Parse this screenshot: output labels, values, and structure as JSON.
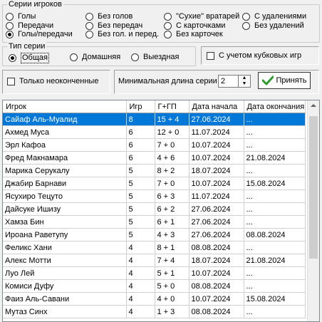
{
  "player_series": {
    "legend": "Серии игроков",
    "options": [
      {
        "label": "Голы",
        "selected": false
      },
      {
        "label": "Передачи",
        "selected": false
      },
      {
        "label": "Голы/передачи",
        "selected": true
      },
      {
        "label": "Без голов",
        "selected": false
      },
      {
        "label": "Без передач",
        "selected": false
      },
      {
        "label": "Без гол. и перед.",
        "selected": false
      },
      {
        "label": "\"Сухие\" вратарей",
        "selected": false
      },
      {
        "label": "С карточками",
        "selected": false
      },
      {
        "label": "Без карточек",
        "selected": false
      },
      {
        "label": "С удалениями",
        "selected": false
      },
      {
        "label": "Без удалений",
        "selected": false
      }
    ]
  },
  "series_type": {
    "legend": "Тип серии",
    "options": [
      {
        "label": "Общая",
        "selected": true
      },
      {
        "label": "Домашняя",
        "selected": false
      },
      {
        "label": "Выездная",
        "selected": false
      }
    ]
  },
  "cup_games_label": "С учетом кубковых игр",
  "unfinished_label": "Только неоконченные",
  "min_length_label": "Минимальная длина серии",
  "min_length_value": "2",
  "accept_label": "Принять",
  "table": {
    "columns": [
      "Игрок",
      "Игр",
      "Г+ГП",
      "Дата начала",
      "Дата окончания"
    ],
    "selected_row": 0,
    "rows": [
      [
        "Сайаф Аль-Муалид",
        "8",
        "15 + 4",
        "27.06.2024",
        "..."
      ],
      [
        "Ахмед Муса",
        "6",
        "12 + 0",
        "11.07.2024",
        "..."
      ],
      [
        "Эрл Кафоа",
        "6",
        "7 + 0",
        "10.07.2024",
        "..."
      ],
      [
        "Фред Макнамара",
        "6",
        "4 + 6",
        "10.07.2024",
        "21.08.2024"
      ],
      [
        "Марика Серукалу",
        "5",
        "8 + 2",
        "18.07.2024",
        "..."
      ],
      [
        "Джабир Барнави",
        "5",
        "7 + 0",
        "10.07.2024",
        "15.08.2024"
      ],
      [
        "Ясухиро Тецуто",
        "5",
        "6 + 3",
        "11.07.2024",
        "..."
      ],
      [
        "Дайсуке Ишизу",
        "5",
        "6 + 2",
        "27.06.2024",
        "..."
      ],
      [
        "Хамза Бин",
        "5",
        "6 + 1",
        "27.06.2024",
        "..."
      ],
      [
        "Ироана Раветупу",
        "5",
        "4 + 3",
        "27.06.2024",
        "08.08.2024"
      ],
      [
        "Феликс Хани",
        "4",
        "8 + 1",
        "08.08.2024",
        "..."
      ],
      [
        "Алекс Мотти",
        "4",
        "7 + 4",
        "18.07.2024",
        "21.08.2024"
      ],
      [
        "Луо Лей",
        "4",
        "5 + 1",
        "10.07.2024",
        "..."
      ],
      [
        "Комиси Дуфу",
        "4",
        "5 + 0",
        "08.08.2024",
        "..."
      ],
      [
        "Фаиз Аль-Савани",
        "4",
        "4 + 0",
        "10.07.2024",
        "15.08.2024"
      ],
      [
        "Мутаз Синх",
        "4",
        "1 + 3",
        "08.08.2024",
        "..."
      ]
    ]
  },
  "colors": {
    "selection": "#0078d7",
    "accept_check": "#2e9d2e"
  }
}
